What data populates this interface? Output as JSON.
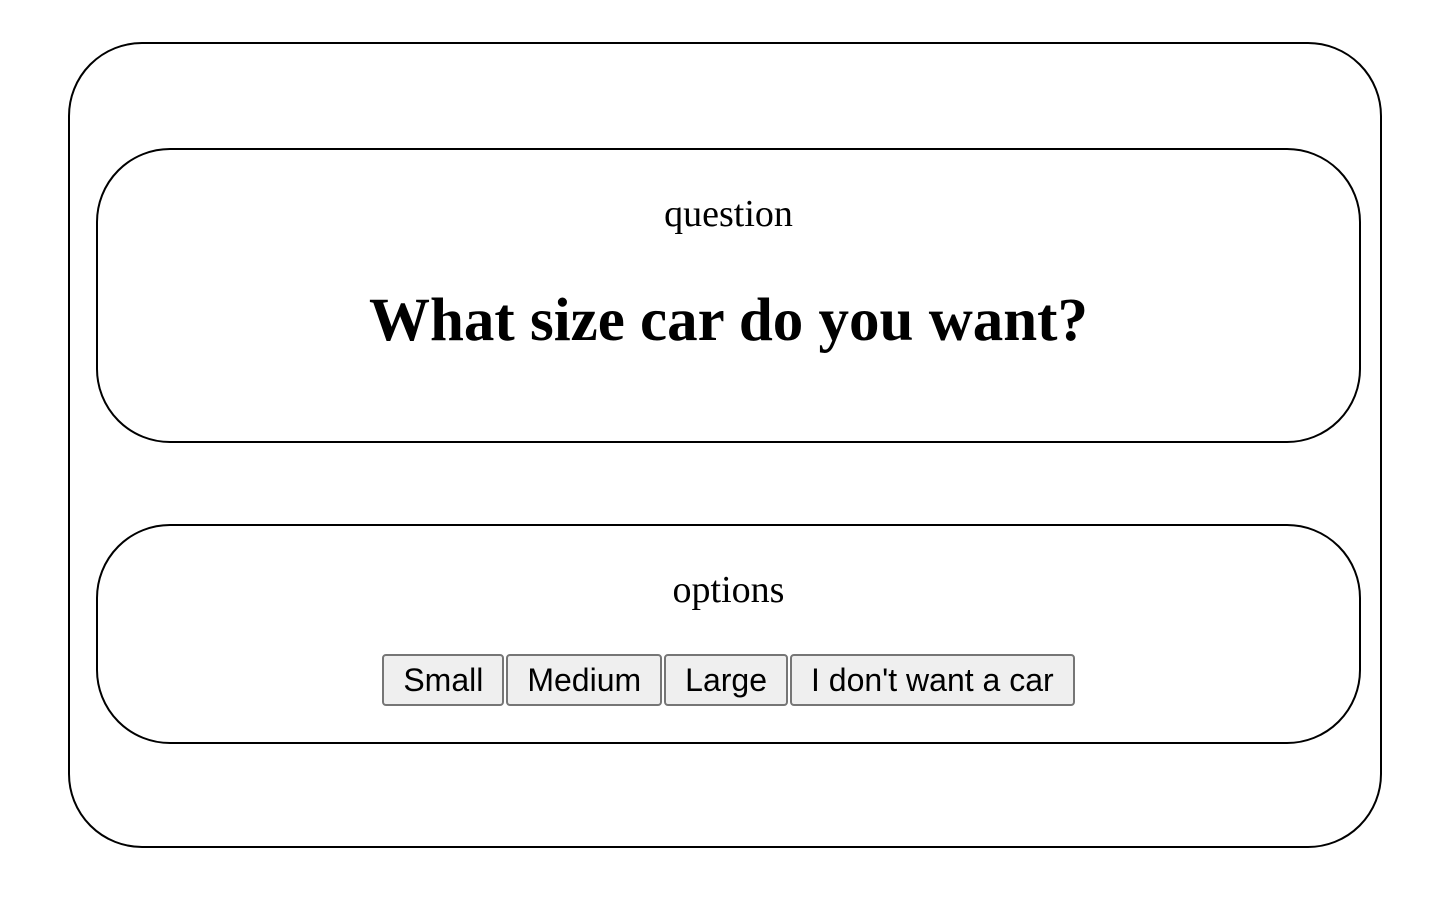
{
  "question_section": {
    "label": "question",
    "text": "What size car do you want?"
  },
  "options_section": {
    "label": "options",
    "buttons": [
      {
        "label": "Small"
      },
      {
        "label": "Medium"
      },
      {
        "label": "Large"
      },
      {
        "label": "I don't want a car"
      }
    ]
  }
}
